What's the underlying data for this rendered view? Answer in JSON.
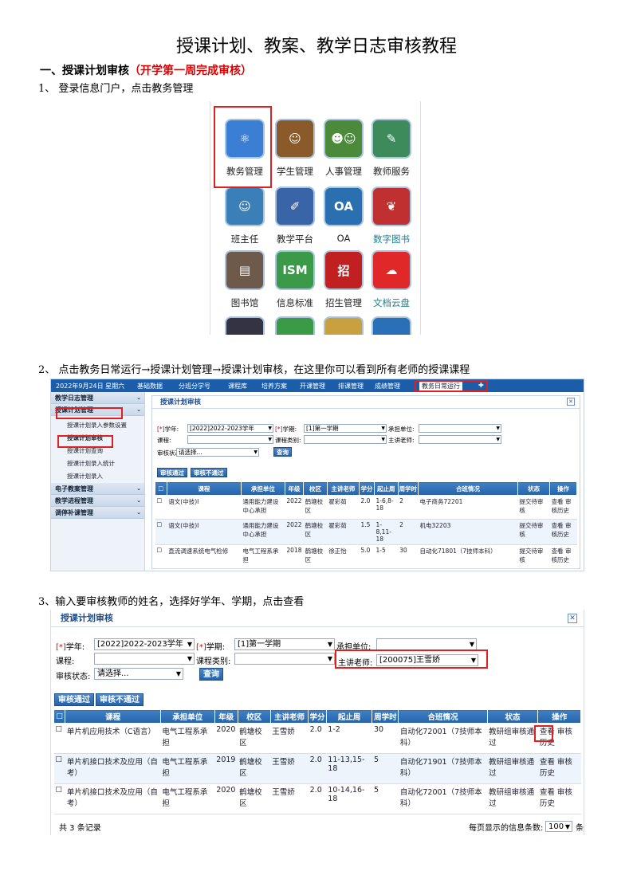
{
  "doc": {
    "title": "授课计划、教案、教学日志审核教程",
    "section1_title": "一、授课计划审核",
    "section1_note": "（开学第一周完成审核）",
    "step1": "1、 登录信息门户，点击教务管理",
    "step2": "2、 点击教务日常运行→授课计划管理→授课计划审核，在这里你可以看到所有老师的授课课程",
    "step3": "3、输入要审核教师的姓名，选择好学年、学期，点击查看"
  },
  "portal": {
    "icons": [
      {
        "label": "教务管理",
        "icon": "atom-icon",
        "color": "#3b7fd4"
      },
      {
        "label": "学生管理",
        "icon": "student-icon",
        "color": "#8a5a2b"
      },
      {
        "label": "人事管理",
        "icon": "people-icon",
        "color": "#4a8a3a"
      },
      {
        "label": "教师服务",
        "icon": "teacher-icon",
        "color": "#3d8a5a"
      },
      {
        "label": "班主任",
        "icon": "user-icon",
        "color": "#3a7fb8"
      },
      {
        "label": "教学平台",
        "icon": "pen-icon",
        "color": "#3a64a8"
      },
      {
        "label": "OA",
        "icon": "oa-icon",
        "color": "#2a6fb0"
      },
      {
        "label": "数字图书",
        "icon": "book-icon",
        "color": "#c03030"
      },
      {
        "label": "图书馆",
        "icon": "library-icon",
        "color": "#6d5a4a"
      },
      {
        "label": "信息标准",
        "icon": "ism-icon",
        "color": "#3b9a48"
      },
      {
        "label": "招生管理",
        "icon": "enroll-icon",
        "color": "#c02020"
      },
      {
        "label": "文档云盘",
        "icon": "cloud-icon",
        "color": "#e02828"
      }
    ]
  },
  "shot1": {
    "topbar": [
      "2022年9月24日 星期六",
      "基础数据",
      "分班分学号",
      "课程库",
      "培养方案",
      "开课管理",
      "排课管理",
      "成绩管理",
      "教务日常运行",
      "✚"
    ],
    "nav_sections": [
      "教学日志管理",
      "授课计划管理",
      "电子教案管理",
      "教学进程管理",
      "调停补课管理"
    ],
    "nav_items": [
      "授课计划录入参数设置",
      "授课计划审核",
      "授课计划查询",
      "授课计划录入统计",
      "授课计划录入"
    ],
    "panel_title": "授课计划审核",
    "labels": {
      "year": "学年:",
      "term": "学期:",
      "unit": "承担单位:",
      "course": "课程:",
      "category": "课程类别:",
      "teacher": "主讲老师:",
      "status": "审核状态:"
    },
    "year_value": "[2022]2022-2023学年",
    "term_value": "[1]第一学期",
    "status_value": "请选择...",
    "query_btn": "查询",
    "pass_btn": "审核通过",
    "fail_btn": "审核不通过",
    "headers": [
      "课程",
      "承担单位",
      "年级",
      "校区",
      "主讲老师",
      "学分",
      "起止周",
      "周学时",
      "合班情况",
      "状态",
      "操作"
    ],
    "rows": [
      [
        "语文(中技)Ⅰ",
        "通用能力建设中心承担",
        "2022",
        "鹤塘校区",
        "翟彩茹",
        "2.0",
        "1-6,8-18",
        "2",
        "电子商务72201",
        "提交待审核",
        "查看 审核历史"
      ],
      [
        "语文(中技)Ⅰ",
        "通用能力建设中心承担",
        "2022",
        "鹤塘校区",
        "翟彩茹",
        "1.5",
        "1-8,11-18",
        "2",
        "机电32203",
        "提交待审核",
        "查看 审核历史"
      ],
      [
        "直流调速系统电气检修",
        "电气工程系承担",
        "2018",
        "鹤塘校区",
        "徐正怡",
        "5.0",
        "1-5",
        "30",
        "自动化71801（7技师本科）",
        "提交待审核",
        "查看 审核历史"
      ]
    ]
  },
  "shot2": {
    "panel_title": "授课计划审核",
    "labels": {
      "year": "学年:",
      "term": "学期:",
      "unit": "承担单位:",
      "course": "课程:",
      "category": "课程类别:",
      "teacher": "主讲老师:",
      "status": "审核状态:"
    },
    "year_value": "[2022]2022-2023学年",
    "term_value": "[1]第一学期",
    "teacher_value": "[200075]王雪娇",
    "status_value": "请选择...",
    "query_btn": "查询",
    "pass_btn": "审核通过",
    "fail_btn": "审核不通过",
    "headers": [
      "课程",
      "承担单位",
      "年级",
      "校区",
      "主讲老师",
      "学分",
      "起止周",
      "周学时",
      "合班情况",
      "状态",
      "操作"
    ],
    "rows": [
      [
        "单片机应用技术（C语言）",
        "电气工程系承担",
        "2020",
        "鹤塘校区",
        "王雪娇",
        "2.0",
        "1-2",
        "30",
        "自动化72001（7技师本科）",
        "教研组审核通过",
        "查看 审核历史"
      ],
      [
        "单片机接口技术及应用（自考）",
        "电气工程系承担",
        "2019",
        "鹤塘校区",
        "王雪娇",
        "2.0",
        "11-13,15-18",
        "5",
        "自动化71901（7技师本科）",
        "教研组审核通过",
        "查看 审核历史"
      ],
      [
        "单片机接口技术及应用（自考）",
        "电气工程系承担",
        "2020",
        "鹤塘校区",
        "王雪娇",
        "2.0",
        "10-14,16-18",
        "5",
        "自动化72001（7技师本科）",
        "教研组审核通过",
        "查看 审核历史"
      ]
    ],
    "total": "共 3 条记录",
    "per_page_label": "每页显示的信息条数:",
    "per_page_value": "100",
    "per_page_unit": "条"
  }
}
